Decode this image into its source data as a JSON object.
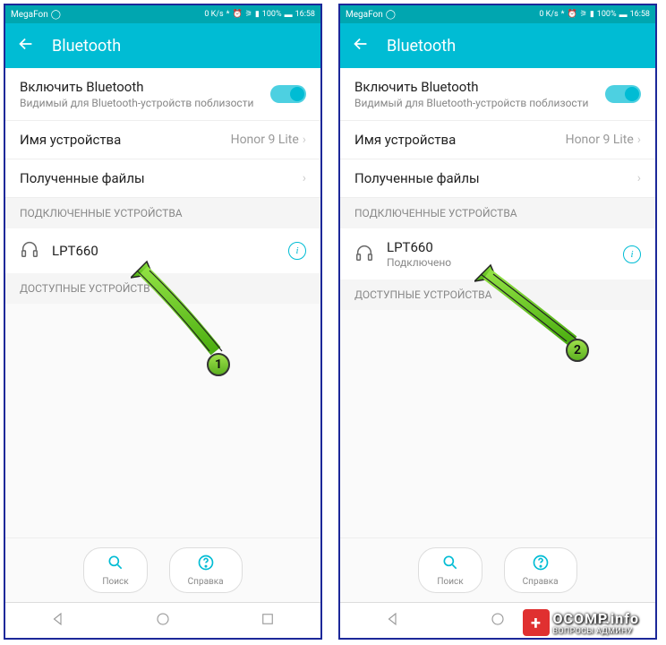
{
  "statusbar": {
    "carrier": "MegaFon",
    "speed": "0 K/s",
    "battery": "100%",
    "time": "16:58"
  },
  "header": {
    "title": "Bluetooth"
  },
  "enableRow": {
    "title": "Включить Bluetooth",
    "sub": "Видимый для Bluetooth-устройств поблизости"
  },
  "deviceNameRow": {
    "title": "Имя устройства",
    "value": "Honor 9 Lite"
  },
  "receivedRow": {
    "title": "Полученные файлы"
  },
  "sections": {
    "connected": "ПОДКЛЮЧЕННЫЕ УСТРОЙСТВА",
    "available": "ДОСТУПНЫЕ УСТРОЙСТВА",
    "availableCut": "ДОСТУПНЫЕ УСТРОЙСТВ"
  },
  "device": {
    "name": "LPT660",
    "status": "Подключено"
  },
  "actions": {
    "search": "Поиск",
    "help": "Справка"
  },
  "annotations": {
    "badge1": "1",
    "badge2": "2"
  },
  "watermark": {
    "main": "OCOMP.info",
    "sub": "ВОПРОСЫ АДМИНУ"
  }
}
